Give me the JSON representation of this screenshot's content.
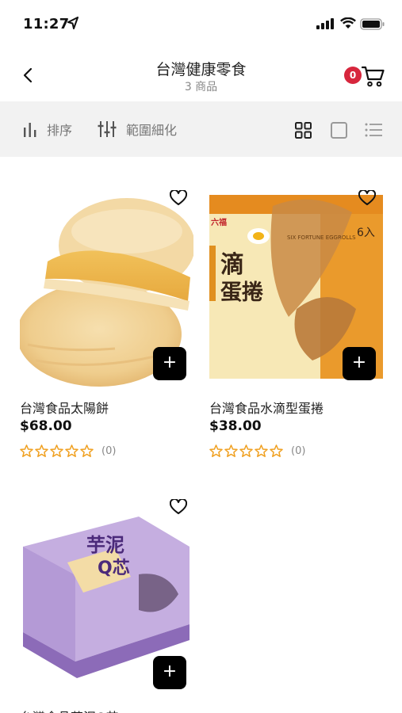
{
  "status_bar": {
    "time": "11:27"
  },
  "header": {
    "title": "台灣健康零食",
    "subtitle": "3 商品",
    "cart_count": "0"
  },
  "toolbar": {
    "sort_label": "排序",
    "filter_label": "範圍細化"
  },
  "colors": {
    "badge": "#d7263d",
    "star": "#f0a020",
    "toolbar_bg": "#f2f2f2"
  },
  "products": [
    {
      "name": "台灣食品太陽餅",
      "price": "$68.00",
      "rating_count": "(0)",
      "stars": 0
    },
    {
      "name": "台灣食品水滴型蛋捲",
      "price": "$38.00",
      "rating_count": "(0)",
      "stars": 0
    },
    {
      "name": "台灣食品芋泥Q芯"
    }
  ],
  "product_art": {
    "eggroll_brand": "六福",
    "eggroll_line": "SIX FORTUNE EGGROLLS",
    "eggroll_big": "滴",
    "eggroll_big2": "蛋捲",
    "eggroll_count": "6入",
    "taro_title1": "芋泥",
    "taro_title2": "Q芯"
  }
}
